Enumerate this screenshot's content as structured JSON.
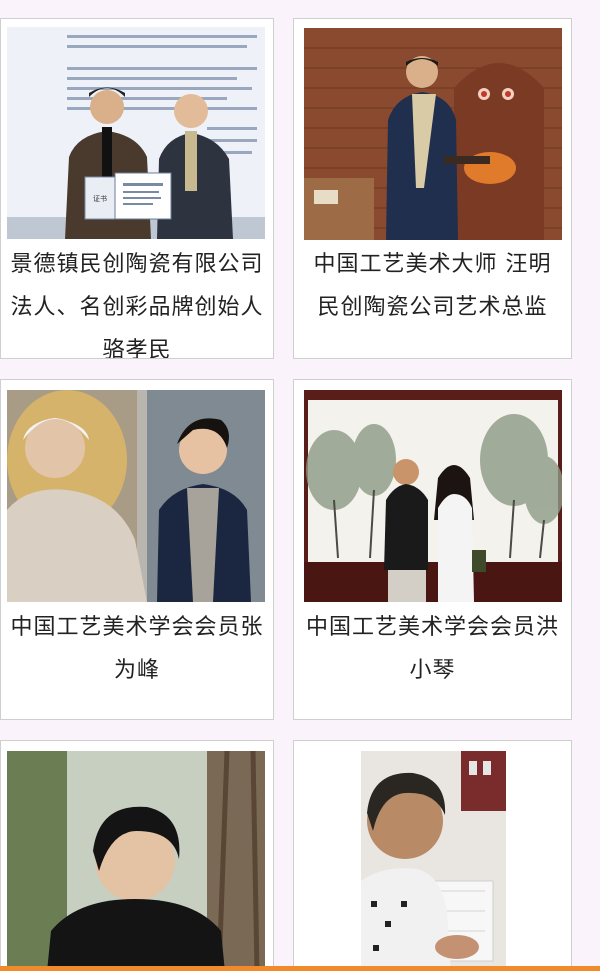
{
  "cards": [
    {
      "caption": "景德镇民创陶瓷有限公司法人、名创彩品牌创始人骆孝民",
      "image": "award-ceremony-photo",
      "certificate_label": "证书"
    },
    {
      "caption": "中国工艺美术大师 汪明 民创陶瓷公司艺术总监",
      "image": "kiln-portrait-photo"
    },
    {
      "caption": "中国工艺美术学会会员张为峰",
      "image": "elder-and-young-man-photo"
    },
    {
      "caption": "中国工艺美术学会会员洪小琴",
      "image": "couple-before-painting-photo"
    },
    {
      "caption": "",
      "image": "outdoor-portrait-photo"
    },
    {
      "caption": "",
      "image": "craftsman-working-photo"
    }
  ],
  "colors": {
    "page_background": "#fbf3fb",
    "accent_bar": "#f08a2b"
  }
}
